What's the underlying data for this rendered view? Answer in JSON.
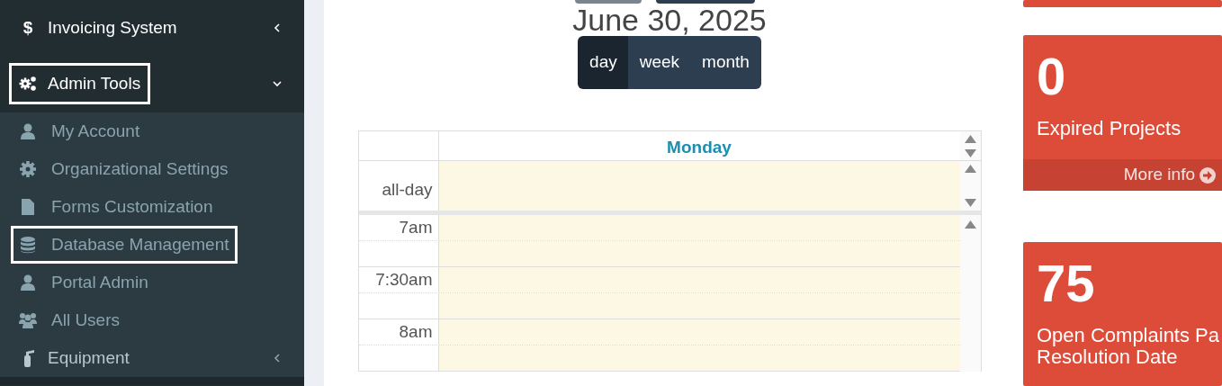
{
  "sidebar": {
    "items": [
      {
        "icon_text": "$",
        "label": "Invoicing System",
        "expanded": false,
        "highlighted": false
      },
      {
        "label": "Admin Tools",
        "expanded": true,
        "highlighted": true,
        "children": [
          {
            "label": "My Account",
            "highlighted": false
          },
          {
            "label": "Organizational Settings",
            "highlighted": false
          },
          {
            "label": "Forms Customization",
            "highlighted": false
          },
          {
            "label": "Database Management",
            "highlighted": true
          },
          {
            "label": "Portal Admin",
            "highlighted": false
          },
          {
            "label": "All Users",
            "highlighted": false
          },
          {
            "label": "Equipment",
            "highlighted": false,
            "kind": "submenu",
            "expanded": false
          }
        ]
      }
    ]
  },
  "calendar": {
    "title": "June 30, 2025",
    "views": [
      {
        "label": "day",
        "selected": true
      },
      {
        "label": "week",
        "selected": false
      },
      {
        "label": "month",
        "selected": false
      }
    ],
    "day_heading": "Monday",
    "all_day_label": "all-day",
    "slots": [
      "7am",
      "7:30am",
      "8am"
    ]
  },
  "info_boxes": [
    {
      "value": "0",
      "label": "Expired Projects",
      "link": "More info"
    },
    {
      "value": "75",
      "label": "Open Complaints Pa\nResolution Date"
    }
  ]
}
